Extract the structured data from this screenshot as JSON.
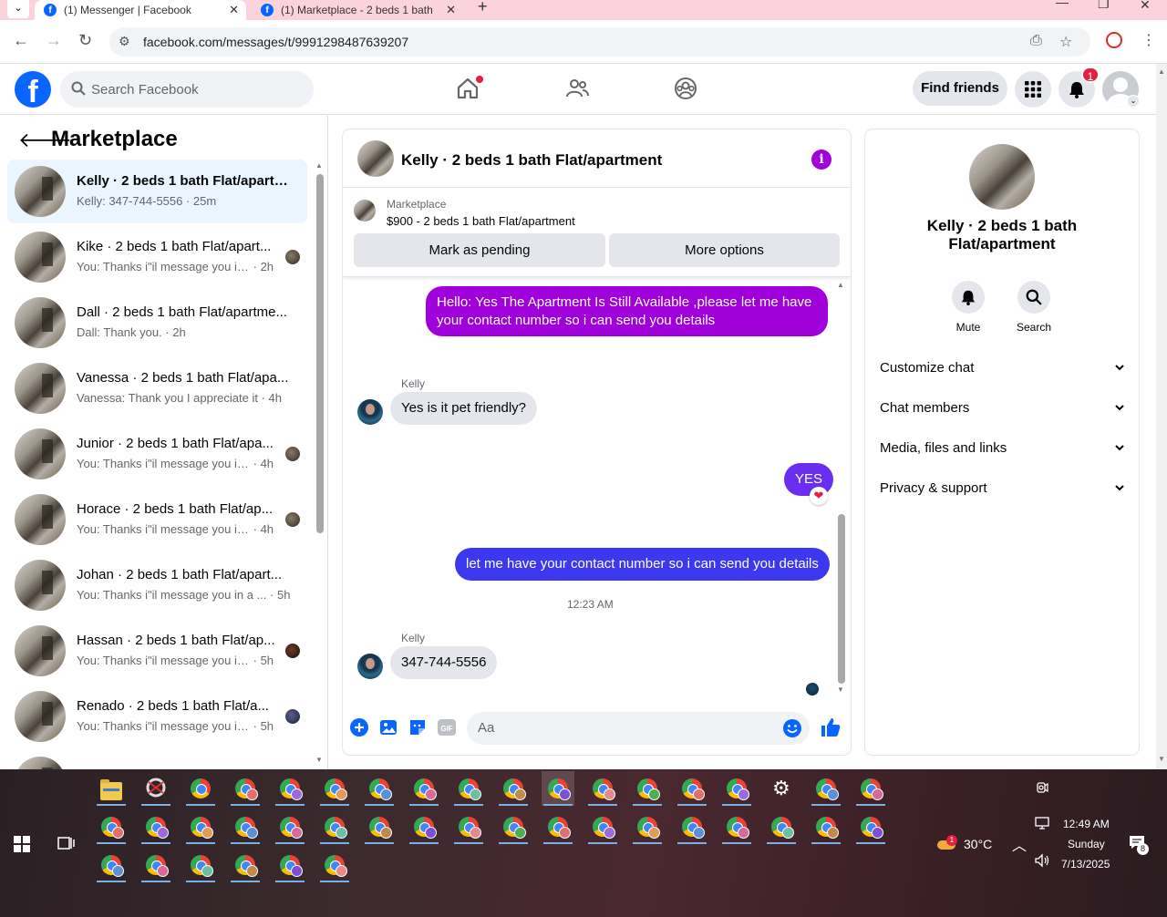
{
  "browser": {
    "tabs": [
      {
        "title": "(1) Messenger | Facebook",
        "active": true
      },
      {
        "title": "(1) Marketplace - 2 beds 1 bath",
        "active": false
      }
    ],
    "url": "facebook.com/messages/t/9991298487639207"
  },
  "fb_header": {
    "search_placeholder": "Search Facebook",
    "find_friends": "Find friends",
    "notification_count": "1"
  },
  "left_panel": {
    "title": "Marketplace",
    "conversations": [
      {
        "name": "Kelly · 2 beds 1 bath Flat/apartm...",
        "snippet": "Kelly: 347-744-5556",
        "time": "25m",
        "selected": true
      },
      {
        "name": "Kike · 2 beds 1 bath Flat/apart...",
        "snippet": "You: Thanks i\"il message you in ...",
        "time": "2h"
      },
      {
        "name": "Dall · 2 beds 1 bath Flat/apartme...",
        "snippet": "Dall: Thank you.",
        "time": "2h"
      },
      {
        "name": "Vanessa · 2 beds 1 bath Flat/apa...",
        "snippet": "Vanessa: Thank you I appreciate it",
        "time": "4h"
      },
      {
        "name": "Junior · 2 beds 1 bath Flat/apa...",
        "snippet": "You: Thanks i\"il message you in ...",
        "time": "4h"
      },
      {
        "name": "Horace · 2 beds 1 bath Flat/ap...",
        "snippet": "You: Thanks i\"il message you in ...",
        "time": "4h"
      },
      {
        "name": "Johan · 2 beds 1 bath Flat/apart...",
        "snippet": "You: Thanks i\"il message you in a ...",
        "time": "5h"
      },
      {
        "name": "Hassan · 2 beds 1 bath Flat/ap...",
        "snippet": "You: Thanks i\"il message you in ...",
        "time": "5h"
      },
      {
        "name": "Renado · 2 beds 1 bath Flat/a...",
        "snippet": "You: Thanks i\"il message you in ...",
        "time": "5h"
      },
      {
        "name": "",
        "snippet": "",
        "time": ""
      }
    ]
  },
  "chat": {
    "title": "Kelly · 2 beds 1 bath Flat/apartment",
    "listing_label": "Marketplace",
    "listing_desc": "$900 - 2 beds 1 bath Flat/apartment",
    "mark_pending": "Mark as pending",
    "more_options": "More options",
    "messages": {
      "m1": "Hello: Yes The Apartment Is Still Available ,please let me have your contact number so i can send you details",
      "sender1": "Kelly",
      "m2": "Yes is it pet friendly?",
      "m3": "YES",
      "m4": "let me have your contact number so i can send you details",
      "timestamp": "12:23 AM",
      "sender2": "Kelly",
      "m5": "347-744-5556"
    },
    "composer_placeholder": "Aa"
  },
  "right_panel": {
    "name": "Kelly · 2 beds 1 bath Flat/apartment",
    "mute": "Mute",
    "search": "Search",
    "sections": [
      "Customize chat",
      "Chat members",
      "Media, files and links",
      "Privacy & support"
    ]
  },
  "taskbar": {
    "weather_badge": "1",
    "temperature": "30°C",
    "time": "12:49 AM",
    "day": "Sunday",
    "date": "7/13/2025",
    "notification_count": "8"
  },
  "colors": {
    "fb_blue": "#0866ff",
    "bubble_purple": "#a000d9",
    "bubble_blue": "#3b38f0",
    "bubble_indigo": "#6a2ef0",
    "selected_bg": "#ebf5ff"
  }
}
